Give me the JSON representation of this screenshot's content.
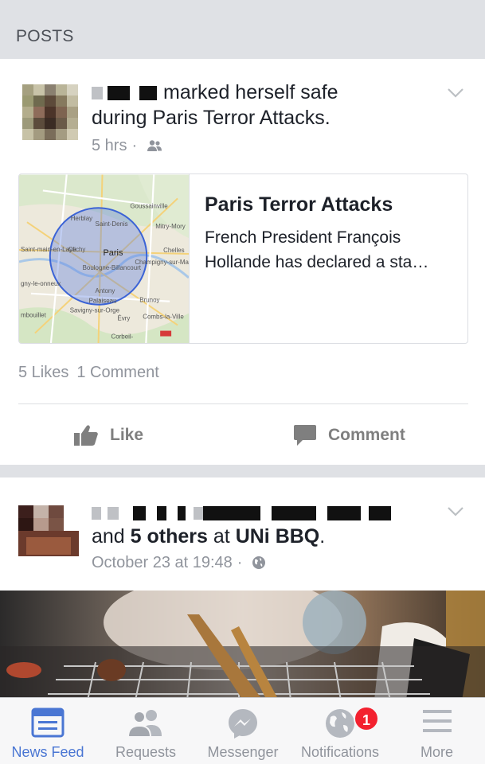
{
  "section": {
    "title": "POSTS"
  },
  "post1": {
    "text_line1": "marked herself safe",
    "text_line2": "during Paris Terror Attacks.",
    "time": "5 hrs",
    "audience_icon": "friends-icon",
    "link": {
      "title": "Paris Terror Attacks",
      "description_line1": "French President François",
      "description_line2": "Hollande has declared a sta…",
      "map_labels": [
        "Herblay",
        "Saint-Denis",
        "Mitry-Mory",
        "Saint-main-en-Laye",
        "Clichy",
        "Paris",
        "Chelles",
        "Champigny-sur-Marne",
        "Boulogne-Billancourt",
        "Antony",
        "Palaiseau",
        "Brunoy",
        "Savigny-sur-Orge",
        "Évry",
        "Combs-la-Ville",
        "Corbeil-",
        "Goussainville",
        "mbouillet",
        "gny-le-onneux"
      ]
    },
    "likes": "5 Likes",
    "comments": "1 Comment",
    "like_label": "Like",
    "comment_label": "Comment"
  },
  "post2": {
    "text_pre": "and ",
    "others": "5 others",
    "at_text": " at ",
    "place": "UNi BBQ",
    "period": ".",
    "time": "October 23 at 19:48",
    "audience_icon": "globe-icon"
  },
  "tabbar": {
    "tabs": [
      {
        "label": "News Feed",
        "icon": "news-feed-icon",
        "active": true
      },
      {
        "label": "Requests",
        "icon": "friend-requests-icon"
      },
      {
        "label": "Messenger",
        "icon": "messenger-icon"
      },
      {
        "label": "Notifications",
        "icon": "notifications-globe-icon",
        "badge": "1"
      },
      {
        "label": "More",
        "icon": "menu-icon"
      }
    ]
  },
  "colors": {
    "accent": "#4a76d3",
    "badge": "#f3212f",
    "muted": "#90949c"
  }
}
